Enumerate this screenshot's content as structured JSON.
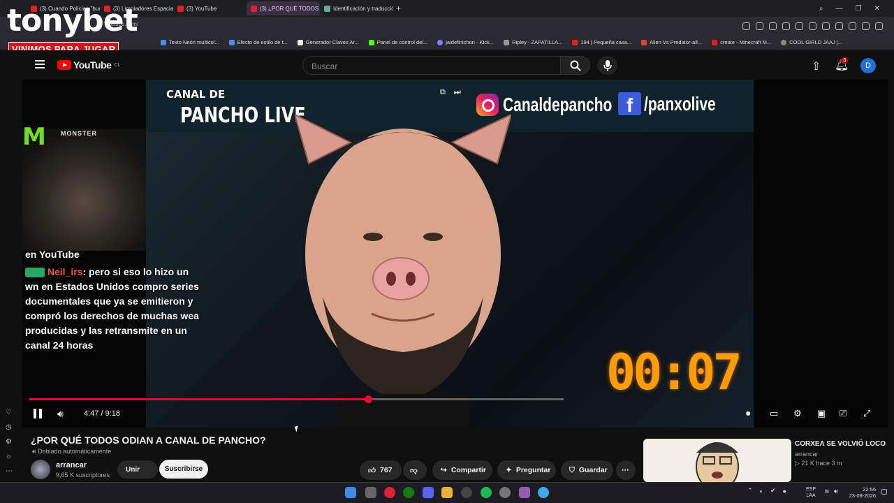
{
  "browser": {
    "tabs": [
      {
        "label": "(3) Cuando Policías \"buen"
      },
      {
        "label": "(3) Limpiadores Espaciales"
      },
      {
        "label": "(3) YouTube"
      },
      {
        "label": "(3) ¿POR QUÉ TODOS"
      },
      {
        "label": "Identificación y traducción"
      }
    ],
    "url": "youtube.com/",
    "bookmarks": [
      "Texto Neón multicol...",
      "Efecto de estilo de t...",
      "Generador Claves Ar...",
      "Panel de control del...",
      "jaidefinichon - Kick...",
      "Ripley - ZAPATILLA...",
      "194 | Pequeña casa...",
      "Alien Vs Predator-alf...",
      "create - Minecraft M...",
      "COOL GIRLD JAAJ |..."
    ]
  },
  "overlay": {
    "brand": "tonybet",
    "tagline": "VINIMOS PARA JUGAR"
  },
  "youtube": {
    "logo_text": "YouTube",
    "region": "CL",
    "search_placeholder": "Buscar",
    "notif_count": "3",
    "avatar_letter": "D"
  },
  "video": {
    "banner_top": "CANAL DE",
    "banner_main": "PANCHO LIVE",
    "instagram_handle": "Canaldepancho",
    "facebook_handle": "/panxolive",
    "monster_text": "MONSTER",
    "chat_header": "en YouTube",
    "chat_user": "Neil_irs",
    "chat_text": ": pero si eso lo hizo un wn en Estados Unidos compro series documentales que ya se emitieron y compró los derechos de muchas wea producidas y las retransmite en un canal 24 horas",
    "timer": "00:07",
    "time_display": "4:47 / 9:18",
    "progress": 0.52
  },
  "details": {
    "title": "¿POR QUÉ TODOS ODIAN A CANAL DE PANCHO?",
    "dubbed": "Doblado automáticamente",
    "channel": "arrancar",
    "subscribers": "9,65 K suscriptores",
    "join_label": "Unir",
    "subscribe_label": "Suscribirse",
    "likes": "767",
    "share_label": "Compartir",
    "ask_label": "Preguntar",
    "save_label": "Guardar"
  },
  "recommended": {
    "title": "CORXEA SE VOLVIÓ LOCO",
    "channel": "arrancar",
    "meta": "▷ 21 K  hace 3 m"
  },
  "taskbar": {
    "lang1": "ESP",
    "lang2": "LAA",
    "time": "22:56",
    "date": "23-08-2026"
  },
  "colors": {
    "accent_red": "#ff0033",
    "timer_orange": "#ff9d00",
    "chat_user": "#ff4d4d"
  }
}
